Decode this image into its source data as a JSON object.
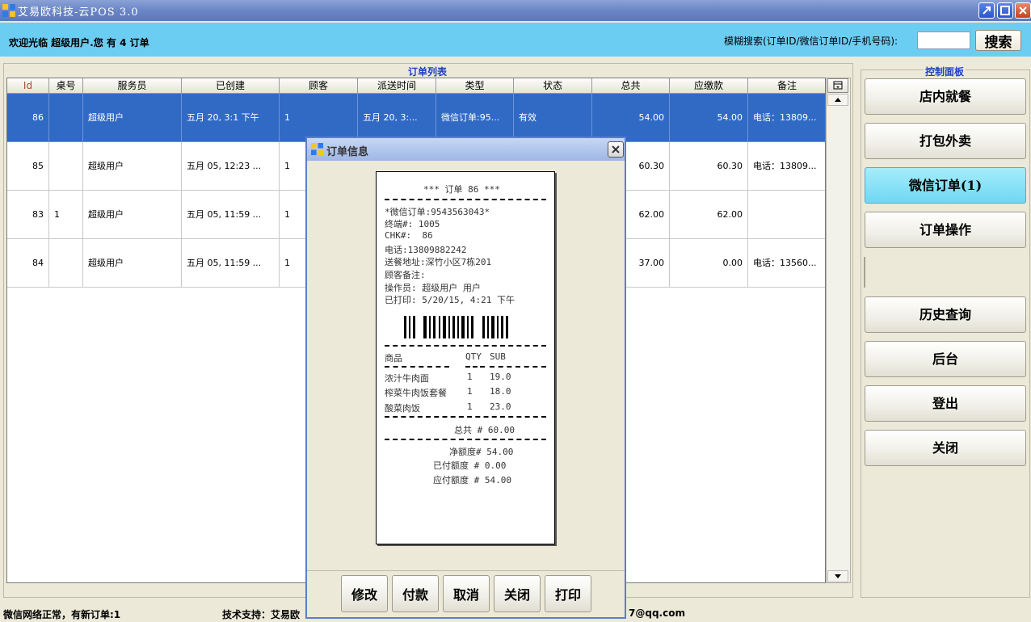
{
  "window": {
    "title": "艾易欧科技-云POS 3.0"
  },
  "header": {
    "welcome": "欢迎光临 超级用户.您 有 4 订单",
    "search_label": "模糊搜索(订单ID/微信订单ID/手机号码):",
    "search_value": "",
    "search_button": "搜索"
  },
  "order_list": {
    "title": "订单列表",
    "columns": [
      "Id",
      "桌号",
      "服务员",
      "已创建",
      "顾客",
      "派送时间",
      "类型",
      "状态",
      "总共",
      "应缴款",
      "备注"
    ],
    "rows": [
      {
        "id": "86",
        "table": "",
        "waiter": "超级用户",
        "created": "五月 20, 3:1 下午",
        "customer": "1",
        "delivery": "五月 20, 3:...",
        "type": "微信订单:95...",
        "status": "有效",
        "total": "54.00",
        "due": "54.00",
        "note": "电话：13809..."
      },
      {
        "id": "85",
        "table": "",
        "waiter": "超级用户",
        "created": "五月 05, 12:23 ...",
        "customer": "1",
        "delivery": "",
        "type": "",
        "status": "",
        "total": "60.30",
        "due": "60.30",
        "note": "电话：13809..."
      },
      {
        "id": "83",
        "table": "1",
        "waiter": "超级用户",
        "created": "五月 05, 11:59 ...",
        "customer": "1",
        "delivery": "",
        "type": "",
        "status": "",
        "total": "62.00",
        "due": "62.00",
        "note": ""
      },
      {
        "id": "84",
        "table": "",
        "waiter": "超级用户",
        "created": "五月 05, 11:59 ...",
        "customer": "1",
        "delivery": "",
        "type": "",
        "status": "",
        "total": "37.00",
        "due": "0.00",
        "note": "电话：13560..."
      }
    ]
  },
  "control_panel": {
    "title": "控制面板",
    "buttons": [
      "店内就餐",
      "打包外卖",
      "微信订单(1)",
      "订单操作",
      "历史查询",
      "后台",
      "登出",
      "关闭"
    ],
    "active": "微信订单(1)"
  },
  "status_bar": {
    "left": "微信网络正常，有新订单:1",
    "mid": "技术支持：艾易欧",
    "right": "7@qq.com"
  },
  "modal": {
    "title": "订单信息",
    "receipt": {
      "header": "*** 订单 86 ***",
      "wechat_order": "*微信订单:9543563043*",
      "terminal": "终端#: 1005",
      "chk": "CHK#:  86",
      "phone": "电话:13809882242",
      "address": "送餐地址:深竹小区7栋201",
      "customer_note": "顾客备注:",
      "operator": "操作员: 超级用户 用户",
      "printed": "已打印: 5/20/15, 4:21 下午",
      "col_item": "商品",
      "col_qty": "QTY",
      "col_sub": "SUB",
      "items": [
        {
          "name": "浓汁牛肉面",
          "qty": "1",
          "sub": "19.0"
        },
        {
          "name": "榨菜牛肉饭套餐",
          "qty": "1",
          "sub": "18.0"
        },
        {
          "name": "酸菜肉饭",
          "qty": "1",
          "sub": "23.0"
        }
      ],
      "total": "总共 # 60.00",
      "net": "净额度# 54.00",
      "paid": "已付额度 # 0.00",
      "due": "应付额度 # 54.00"
    },
    "buttons": [
      "修改",
      "付款",
      "取消",
      "关闭",
      "打印"
    ]
  },
  "colors": {
    "header_bg": "#6ccdf3",
    "selected_row": "#316ac5",
    "panel_title": "#1d41c5",
    "active_button": "#6fd8f3"
  },
  "icons": [
    "app-icon",
    "minimize-icon",
    "maximize-icon",
    "close-icon",
    "column-menu-icon",
    "scroll-up-icon",
    "scroll-down-icon",
    "modal-app-icon",
    "modal-close-icon",
    "barcode-image"
  ]
}
